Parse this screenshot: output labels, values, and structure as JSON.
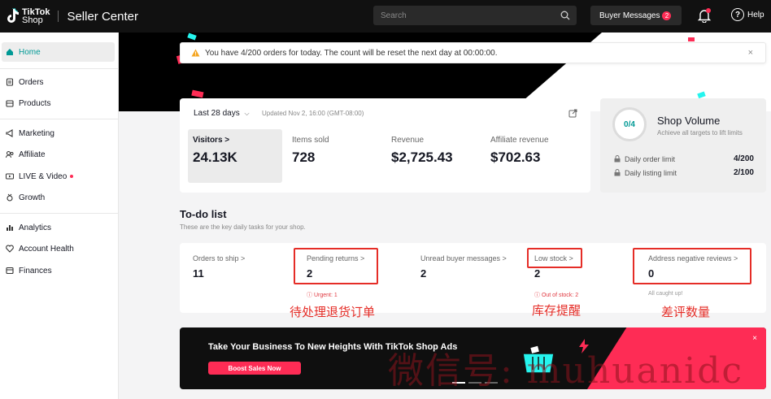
{
  "topbar": {
    "logo_text_1": "TikTok",
    "logo_text_2": "Shop",
    "title": "Seller Center",
    "search_placeholder": "Search",
    "buyer_messages_label": "Buyer Messages",
    "buyer_messages_count": "2",
    "help_label": "Help"
  },
  "sidebar": {
    "items": [
      {
        "label": "Home",
        "icon": "home-icon"
      },
      {
        "label": "Orders",
        "icon": "orders-icon"
      },
      {
        "label": "Products",
        "icon": "products-icon"
      },
      {
        "label": "Marketing",
        "icon": "megaphone-icon"
      },
      {
        "label": "Affiliate",
        "icon": "people-icon"
      },
      {
        "label": "LIVE & Video",
        "icon": "video-icon"
      },
      {
        "label": "Growth",
        "icon": "medal-icon"
      },
      {
        "label": "Analytics",
        "icon": "chart-icon"
      },
      {
        "label": "Account Health",
        "icon": "heart-icon"
      },
      {
        "label": "Finances",
        "icon": "finance-icon"
      }
    ]
  },
  "banner": {
    "text": "You have 4/200 orders for today. The count will be reset the next day at 00:00:00.",
    "close": "×"
  },
  "stats": {
    "range": "Last 28 days",
    "updated": "Updated Nov 2, 16:00 (GMT-08:00)",
    "metrics": [
      {
        "label": "Visitors >",
        "value": "24.13K"
      },
      {
        "label": "Items sold",
        "value": "728"
      },
      {
        "label": "Revenue",
        "value": "$2,725.43"
      },
      {
        "label": "Affiliate revenue",
        "value": "$702.63"
      }
    ]
  },
  "volume": {
    "progress": "0/4",
    "title": "Shop Volume",
    "subtitle": "Achieve all targets to lift limits",
    "limits": [
      {
        "label": "Daily order limit",
        "value": "4/200"
      },
      {
        "label": "Daily listing limit",
        "value": "2/100"
      }
    ]
  },
  "todo": {
    "title": "To-do list",
    "subtitle": "These are the key daily tasks for your shop.",
    "items": [
      {
        "label": "Orders to ship >",
        "value": "11"
      },
      {
        "label": "Pending returns >",
        "value": "2"
      },
      {
        "label": "Unread buyer messages >",
        "value": "2"
      },
      {
        "label": "Low stock >",
        "value": "2"
      },
      {
        "label": "Address negative reviews >",
        "value": "0"
      }
    ],
    "notes": {
      "urgent": "Urgent: 1",
      "out_of_stock": "Out of stock: 2",
      "caught_up": "All caught up!"
    },
    "annotations": [
      "待处理退货订单",
      "库存提醒",
      "差评数量"
    ]
  },
  "ads": {
    "title": "Take Your Business To New Heights With TikTok Shop Ads",
    "button": "Boost Sales Now",
    "close": "×"
  },
  "watermark": "微信号: muhuanidc",
  "colors": {
    "accent": "#009995",
    "brand_red": "#fe2c55",
    "annotation_red": "#e52d27"
  }
}
